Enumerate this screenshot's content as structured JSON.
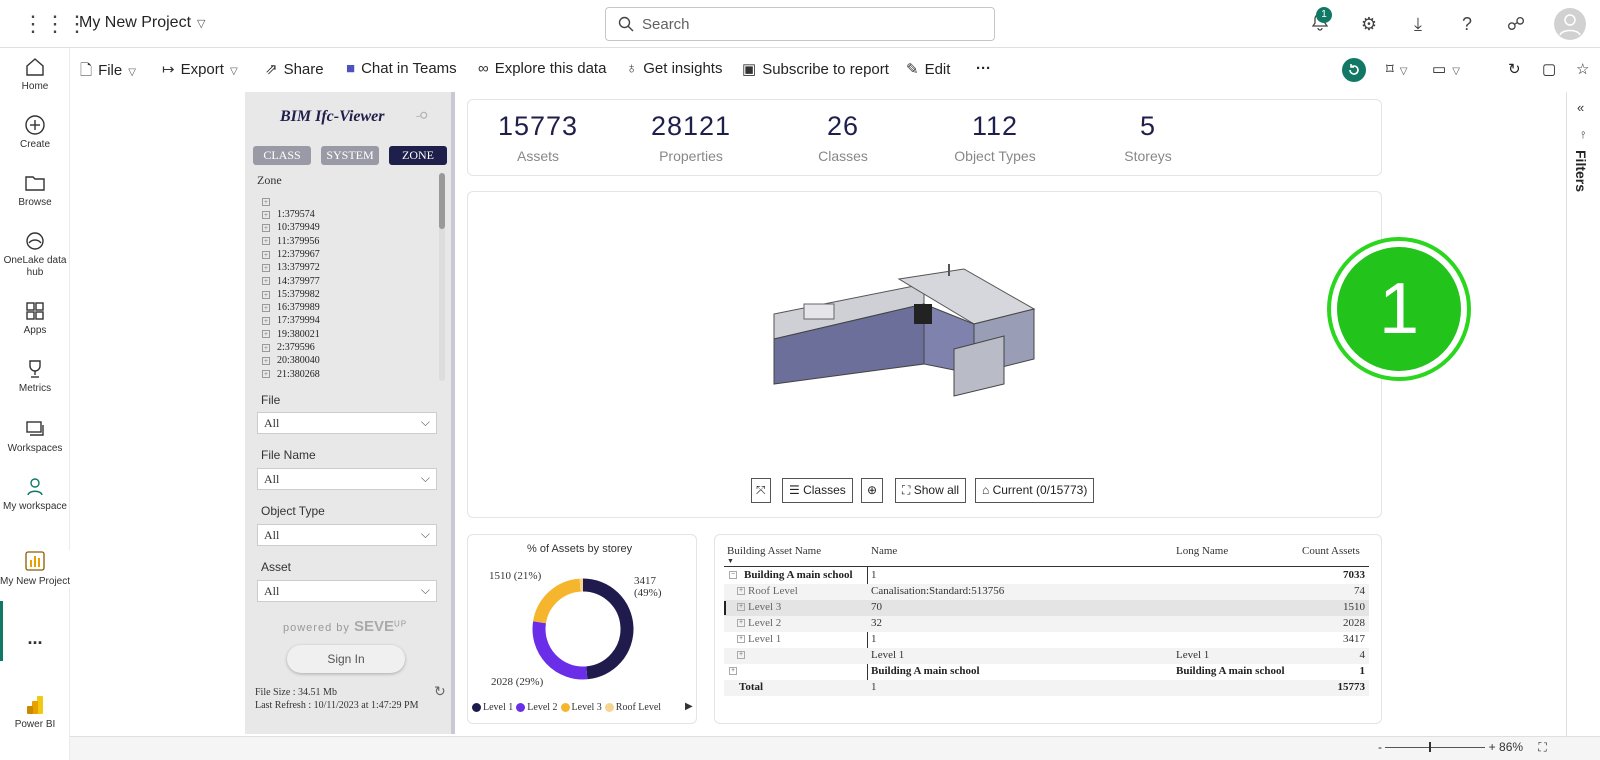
{
  "topbar": {
    "project_name": "My New Project",
    "search_placeholder": "Search",
    "notification_count": "1"
  },
  "nav": {
    "items": [
      {
        "label": "Home"
      },
      {
        "label": "Create"
      },
      {
        "label": "Browse"
      },
      {
        "label": "OneLake data hub"
      },
      {
        "label": "Apps"
      },
      {
        "label": "Metrics"
      },
      {
        "label": "Workspaces"
      },
      {
        "label": "My workspace"
      },
      {
        "label": "My New Project"
      },
      {
        "label": "..."
      },
      {
        "label": "Power BI"
      }
    ]
  },
  "toolbar": {
    "file": "File",
    "export": "Export",
    "share": "Share",
    "chat": "Chat in Teams",
    "explore": "Explore this data",
    "insights": "Get insights",
    "subscribe": "Subscribe to report",
    "edit": "Edit",
    "more": "···"
  },
  "right_pane": {
    "filters": "Filters"
  },
  "report": {
    "title": "BIM Ifc-Viewer",
    "tabs": [
      "CLASS",
      "SYSTEM",
      "ZONE"
    ],
    "zone_label": "Zone",
    "zone_items": [
      "1:379574",
      "10:379949",
      "11:379956",
      "12:379967",
      "13:379972",
      "14:379977",
      "15:379982",
      "16:379989",
      "17:379994",
      "19:380021",
      "2:379596",
      "20:380040",
      "21:380268"
    ],
    "filters": [
      {
        "label": "File",
        "value": "All"
      },
      {
        "label": "File Name",
        "value": "All"
      },
      {
        "label": "Object Type",
        "value": "All"
      },
      {
        "label": "Asset",
        "value": "All"
      }
    ],
    "powered_by": "powered by",
    "brand": "SEVE",
    "brand_sup": "UP",
    "sign_in": "Sign In",
    "file_size": "File Size : 34.51 Mb",
    "last_refresh": "Last Refresh : 10/11/2023 at 1:47:29 PM"
  },
  "stats": [
    {
      "value": "15773",
      "label": "Assets"
    },
    {
      "value": "28121",
      "label": "Properties"
    },
    {
      "value": "26",
      "label": "Classes"
    },
    {
      "value": "112",
      "label": "Object Types"
    },
    {
      "value": "5",
      "label": "Storeys"
    }
  ],
  "viewer": {
    "classes_btn": "Classes",
    "show_all_btn": "Show all",
    "current_btn": "Current (0/15773)"
  },
  "chart_data": {
    "type": "pie",
    "title": "% of Assets by storey",
    "categories": [
      "Level 1",
      "Level 2",
      "Level 3",
      "Roof Level"
    ],
    "values": [
      3417,
      2028,
      1510,
      74
    ],
    "labels": [
      "3417 (49%)",
      "2028 (29%)",
      "1510 (21%)",
      ""
    ],
    "colors": [
      "#1f1b4d",
      "#6a2ee8",
      "#f5b62e",
      "#f6d58e"
    ],
    "legend_position": "bottom"
  },
  "table": {
    "headers": [
      "Building Asset Name",
      "Name",
      "Long Name",
      "Count Assets"
    ],
    "rows": [
      {
        "asset": "Building A main school",
        "name": "1",
        "long": "",
        "count": "7033"
      },
      {
        "asset": "Roof Level",
        "name": "Canalisation:Standard:513756",
        "long": "",
        "count": "74"
      },
      {
        "asset": "Level 3",
        "name": "70",
        "long": "",
        "count": "1510"
      },
      {
        "asset": "Level 2",
        "name": "32",
        "long": "",
        "count": "2028"
      },
      {
        "asset": "Level 1",
        "name": "1",
        "long": "",
        "count": "3417"
      },
      {
        "asset": "",
        "name": "Level 1",
        "long": "Level 1",
        "count": "4"
      },
      {
        "asset": "",
        "name": "Building A main school",
        "long": "Building A main school",
        "count": "1"
      },
      {
        "asset": "Total",
        "name": "1",
        "long": "",
        "count": "15773"
      }
    ]
  },
  "status": {
    "zoom": "86%"
  },
  "callout": {
    "number": "1"
  }
}
